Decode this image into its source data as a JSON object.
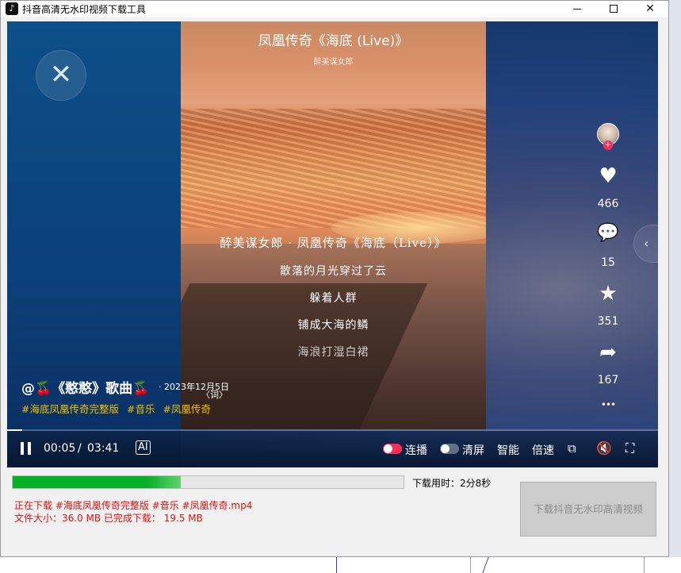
{
  "window": {
    "title": "抖音高清无水印视频下载工具",
    "minimize": "—",
    "maximize": "□",
    "close": "✕"
  },
  "video": {
    "title": "凤凰传奇《海底 (Live)》",
    "subtitle": "醉美谋女郎",
    "lyrics_head": "醉美谋女郎 · 凤凰传奇《海底（Live）》",
    "lyrics": [
      "散落的月光穿过了云",
      "躲着人群",
      "铺成大海的鳞",
      "海浪打湿白裙"
    ],
    "close_icon": "✕"
  },
  "actions": {
    "avatar_plus": "+",
    "like_icon": "♥",
    "likes": "466",
    "comment_icon": "💬",
    "comments": "15",
    "star_icon": "★",
    "favorites": "351",
    "share_icon": "➦",
    "shares": "167",
    "more_icon": "•••",
    "side_arrow": "‹"
  },
  "post": {
    "author": "@🍒《憨憨》歌曲🍒",
    "date": "· 2023年12月5日",
    "lyric_button": "〈词〉",
    "tags": [
      "#海底凤凰传奇完整版",
      "#音乐",
      "#凤凰传奇"
    ]
  },
  "controls": {
    "current_time": "00:05",
    "separator": "/",
    "total_time": "03:41",
    "subtitle_icon": "AI",
    "autoplay": "连播",
    "clear_screen": "清屏",
    "smart": "智能",
    "speed": "倍速",
    "pip_icon": "⧉",
    "mute_icon": "🔇",
    "fullscreen_icon": "⛶",
    "progress": 0.023
  },
  "download": {
    "progress": 0.43,
    "elapsed_label": "下载用时：2分8秒",
    "status_line1": "正在下载  #海底凤凰传奇完整版 #音乐 #凤凰传奇.mp4",
    "status_line2": "文件大小：36.0 MB   已完成下载：  19.5 MB",
    "button_label": "下载抖音无水印高清视频"
  }
}
